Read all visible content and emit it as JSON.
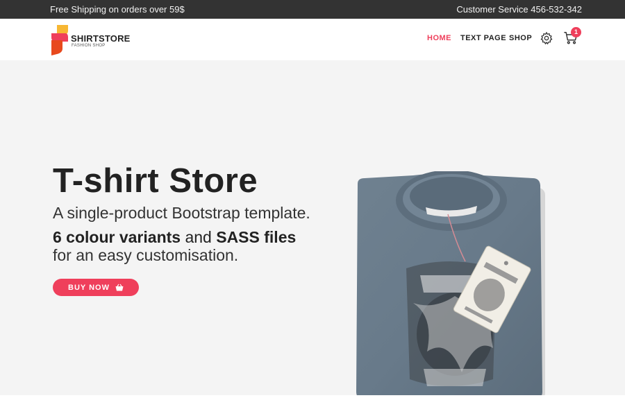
{
  "topbar": {
    "shipping_text": "Free Shipping on orders over 59$",
    "service_text": "Customer Service 456-532-342"
  },
  "brand": {
    "name": "SHIRTSTORE",
    "tagline": "FASHION SHOP",
    "logo_colors": [
      "#f7b733",
      "#ef3f5b",
      "#e8491d"
    ]
  },
  "nav": {
    "items": [
      {
        "label": "HOME",
        "active": true
      },
      {
        "label": "TEXT PAGE",
        "active": false
      },
      {
        "label": "SHOP",
        "active": false
      }
    ],
    "settings_icon": "gear-icon",
    "cart_icon": "shopping-cart-icon",
    "cart_count": "1"
  },
  "hero": {
    "title": "T-shirt Store",
    "subtitle": "A single-product Bootstrap template.",
    "highlight_1": "6 colour variants",
    "connector": "and",
    "highlight_2": "SASS files",
    "tail": "for an easy customisation.",
    "cta_label": "BUY NOW",
    "cta_icon": "shopping-basket-icon",
    "product_image": "folded-grey-tshirt-image"
  },
  "colors": {
    "accent": "#ef3f5b",
    "topbar_bg": "#333333",
    "hero_bg": "#f4f4f4"
  }
}
